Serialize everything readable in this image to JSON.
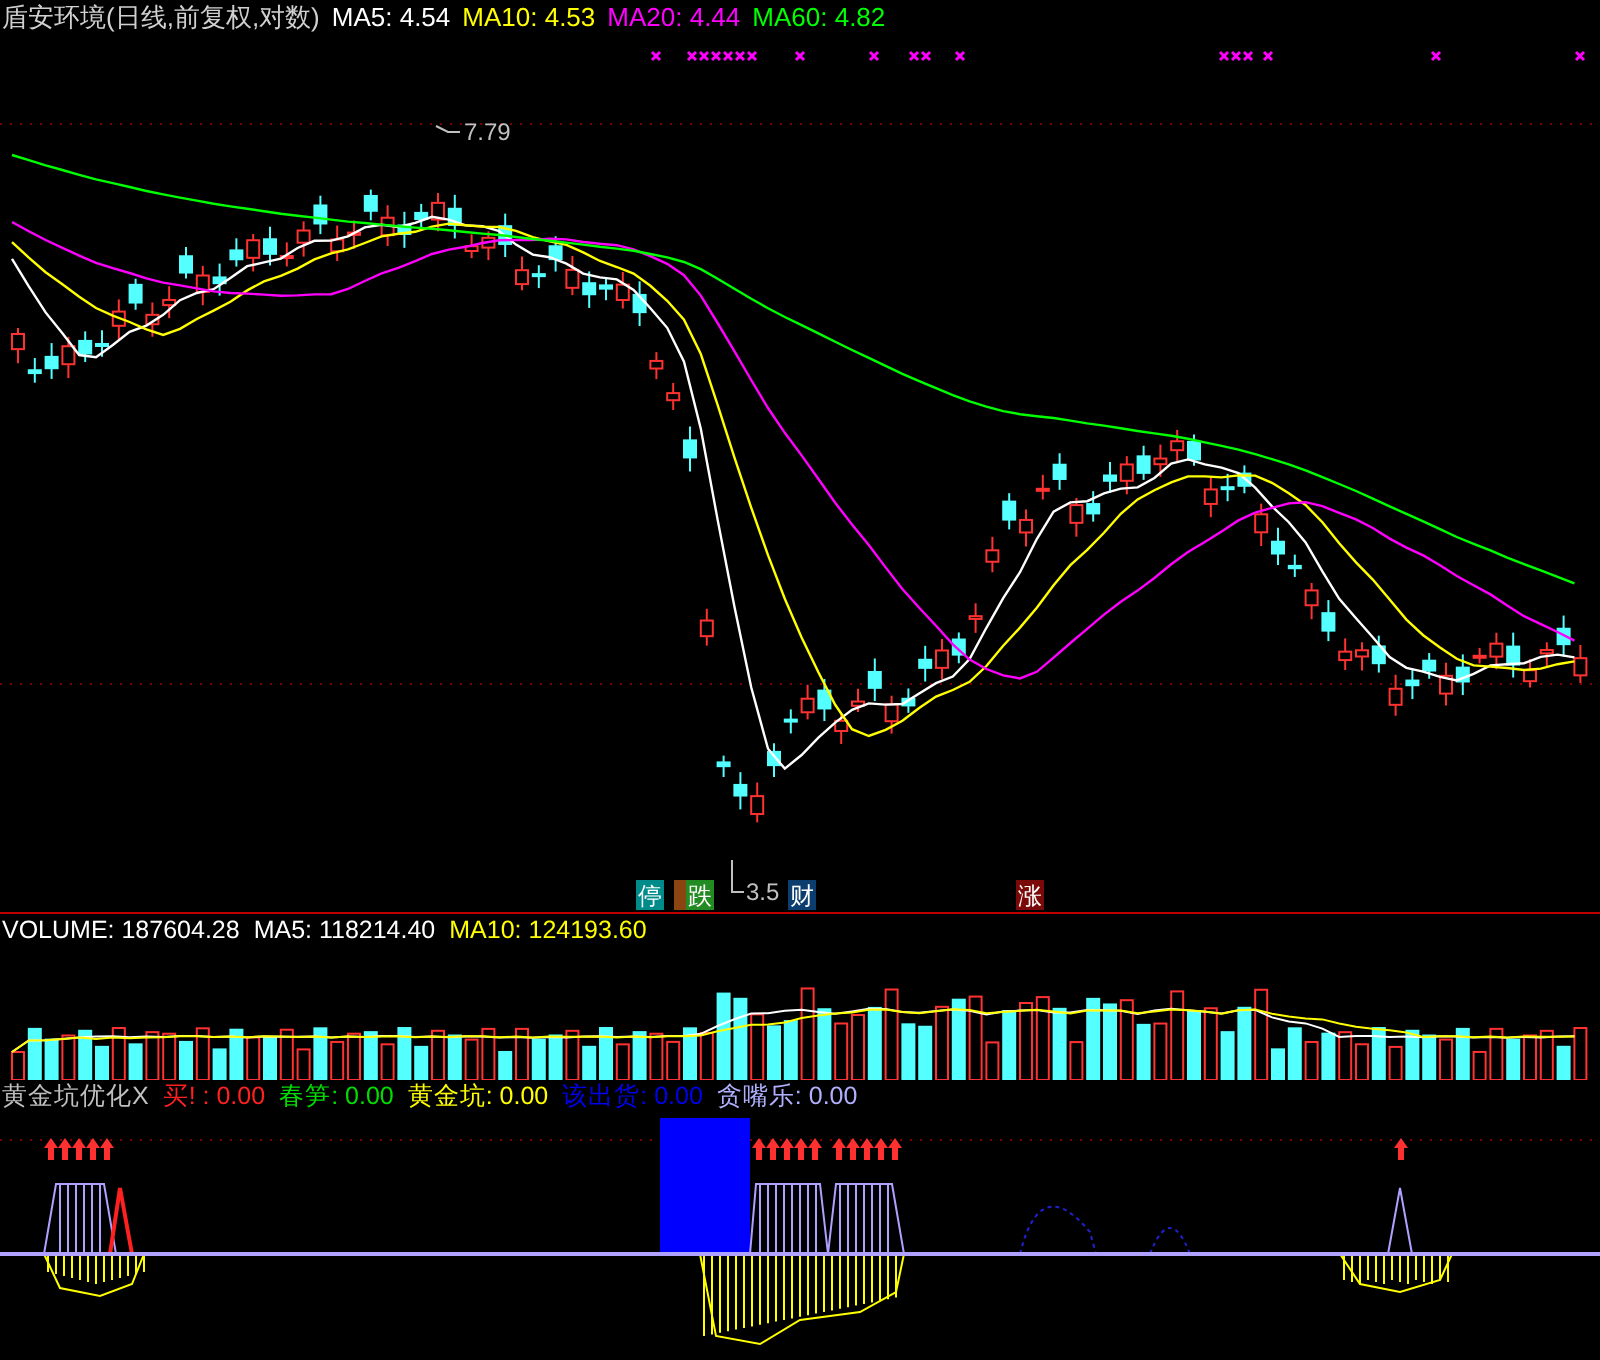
{
  "price_panel": {
    "title": "盾安环境(日线,前复权,对数)",
    "legend": [
      {
        "text": "MA5: 4.54",
        "color": "#ffffff"
      },
      {
        "text": "MA10: 4.53",
        "color": "#ffff00"
      },
      {
        "text": "MA20: 4.44",
        "color": "#ff00ff"
      },
      {
        "text": "MA60: 4.82",
        "color": "#00ff00"
      }
    ],
    "price_labels": [
      {
        "kind": "high",
        "text": "7.79"
      },
      {
        "kind": "low",
        "text": "3.5"
      }
    ],
    "badges": [
      {
        "text": "停",
        "color": "#008b8b"
      },
      {
        "color": "#8b4513"
      },
      {
        "text": "跌",
        "color": "#228b22"
      },
      {
        "text": "财",
        "color": "#0b3d6e"
      },
      {
        "text": "涨",
        "color": "#7a0a0a"
      }
    ]
  },
  "volume_panel": {
    "legend": [
      {
        "text": "VOLUME: 187604.28",
        "color": "#ffffff"
      },
      {
        "text": "MA5: 118214.40",
        "color": "#ffffff"
      },
      {
        "text": "MA10: 124193.60",
        "color": "#ffff00"
      }
    ]
  },
  "indicator_panel": {
    "legend": [
      {
        "text": "黄金坑优化X",
        "color": "#c0c0c0"
      },
      {
        "text": "买! : 0.00",
        "color": "#ff2020"
      },
      {
        "text": "春笋: 0.00",
        "color": "#00dd00"
      },
      {
        "text": "黄金坑: 0.00",
        "color": "#ffff00"
      },
      {
        "text": "该出货: 0.00",
        "color": "#0000ee"
      },
      {
        "text": "贪嘴乐: 0.00",
        "color": "#b0b0ff"
      }
    ]
  }
}
